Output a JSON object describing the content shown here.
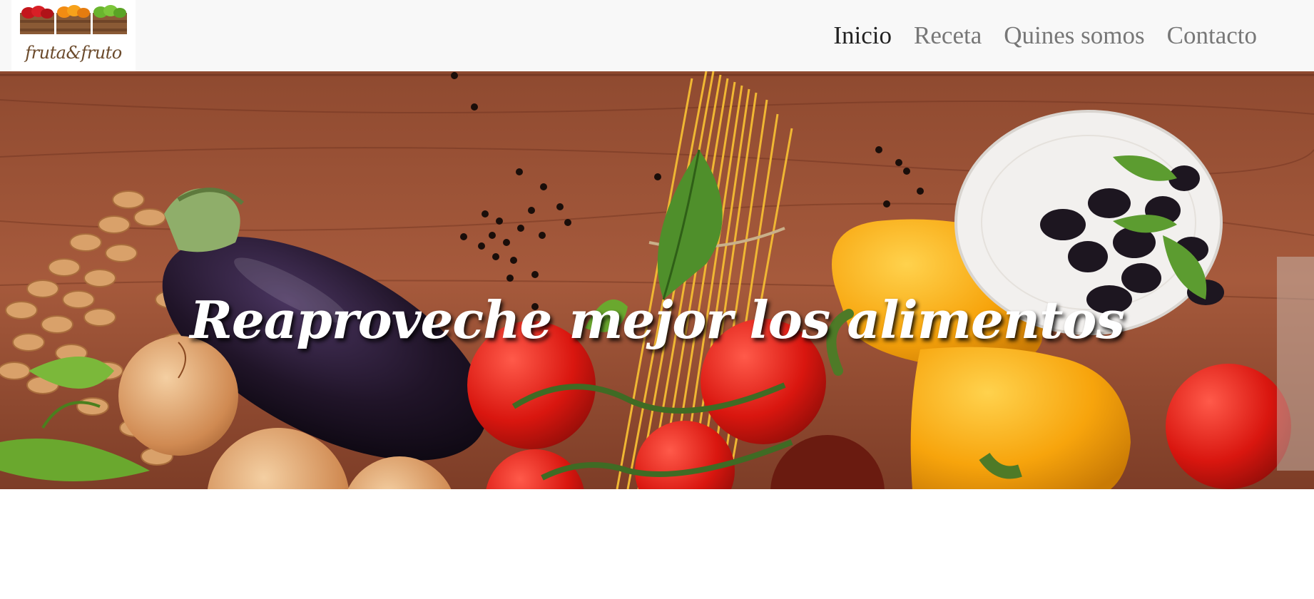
{
  "brand": {
    "name": "fruta&fruto"
  },
  "nav": {
    "items": [
      {
        "label": "Inicio",
        "active": true
      },
      {
        "label": "Receta",
        "active": false
      },
      {
        "label": "Quines somos",
        "active": false
      },
      {
        "label": "Contacto",
        "active": false
      }
    ]
  },
  "hero": {
    "title": "Reaproveche mejor los alimentos"
  },
  "colors": {
    "navbar_bg": "#f8f8f8",
    "nav_active": "#222222",
    "nav_inactive": "#777777",
    "hero_text": "#ffffff"
  }
}
